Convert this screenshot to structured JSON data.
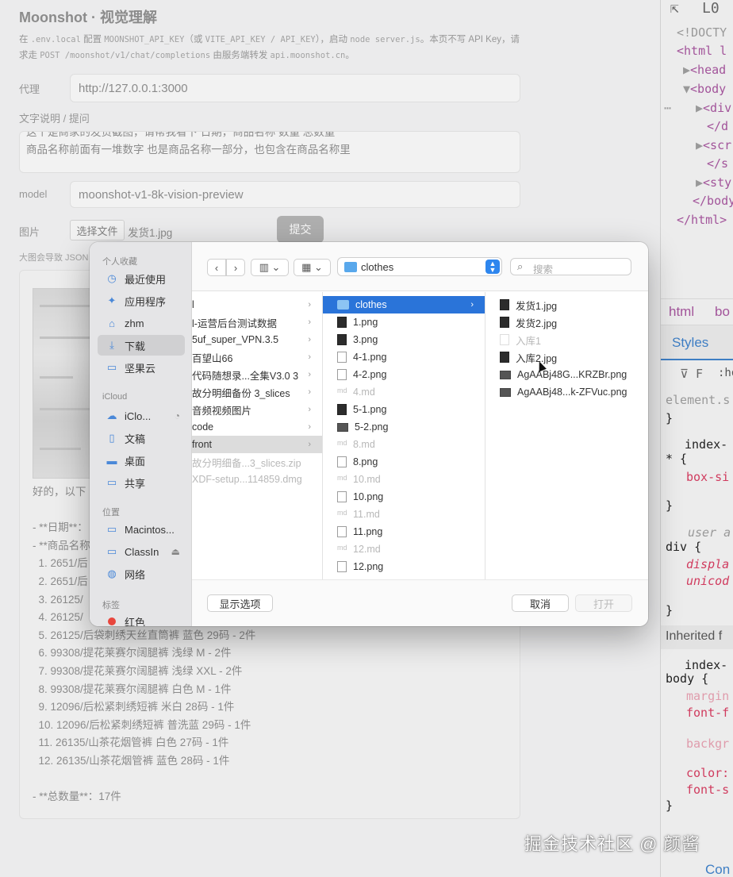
{
  "page": {
    "title": "Moonshot · 视觉理解",
    "desc": {
      "p1": "在 ",
      "c1": ".env.local",
      "p2": " 配置 ",
      "c2": "MOONSHOT_API_KEY",
      "p3": "（或 ",
      "c3": "VITE_API_KEY / API_KEY",
      "p4": "），启动 ",
      "c4": "node server.js",
      "p5": "。本页不写 API Key，请求走 ",
      "c5": "POST /moonshot/v1/chat/completions",
      "p6": " 由服务端转发 ",
      "c6": "api.moonshot.cn",
      "p7": "。"
    },
    "proxy": {
      "label": "代理",
      "value": "http://127.0.0.1:3000"
    },
    "prompt": {
      "label": "文字说明 / 提问",
      "line1": "这个是商家的发货截图，请帮我看下 日期，商品名称 数量 总数量",
      "line2": "商品名称前面有一堆数字 也是商品名称一部分，也包含在商品名称里"
    },
    "model": {
      "label": "model",
      "value": "moonshot-v1-8k-vision-preview"
    },
    "image": {
      "label": "图片",
      "choose_button": "选择文件",
      "file_name": "发货1.jpg"
    },
    "submit": "提交",
    "size_hint": "大图会导致 JSON",
    "result_lines": [
      "好的，以下",
      "",
      "- **日期**：",
      "- **商品名称",
      "  1. 2651/后",
      "  2. 2651/后",
      "  3. 26125/",
      "  4. 26125/",
      "  5. 26125/后袋刺绣天丝直筒裤 蓝色 29码 - 2件",
      "  6. 99308/提花莱赛尔阔腿裤 浅绿 M - 2件",
      "  7. 99308/提花莱赛尔阔腿裤 浅绿 XXL - 2件",
      "  8. 99308/提花莱赛尔阔腿裤 白色 M - 1件",
      "  9. 12096/后松紧刺绣短裤 米白 28码 - 1件",
      "  10. 12096/后松紧刺绣短裤 普洗蓝 29码 - 1件",
      "  11. 26135/山茶花烟管裤 白色 27码 - 1件",
      "  12. 26135/山茶花烟管裤 蓝色 28码 - 1件",
      "",
      "- **总数量**：17件"
    ]
  },
  "devtools": {
    "icon_a": "⇱",
    "icon_b": "L0",
    "doctype": "<!DOCTY",
    "html_open": "<html l",
    "head": "<head",
    "body": "<body",
    "div": "<div",
    "div_close": "</d",
    "script": "<scr",
    "script_close": "</s",
    "style": "<sty",
    "body_close": "</body",
    "html_close": "</html>",
    "crumb_html": "html",
    "crumb_body": "bo",
    "styles_tab": "Styles",
    "filter": ":ho",
    "element_style": "element.s",
    "close_brace": "}",
    "index_1": "index-",
    "star_rule": "* {",
    "box_sizing": "box-si",
    "user_agent": "user a",
    "div_rule": "div {",
    "display": "displa",
    "unicode": "unicod",
    "inherited": "Inherited f",
    "index_2": "index-",
    "body_rule": "body {",
    "margin": "margin",
    "font_f": "font-f",
    "background": "backgr",
    "color": "color:",
    "font_s": "font-s",
    "console": "Con"
  },
  "dialog": {
    "sidebar": {
      "favorites_header": "个人收藏",
      "favorites": [
        {
          "label": "最近使用",
          "icon": "clock-icon"
        },
        {
          "label": "应用程序",
          "icon": "apps-icon"
        },
        {
          "label": "zhm",
          "icon": "home-icon"
        },
        {
          "label": "下载",
          "icon": "download-icon",
          "active": true
        },
        {
          "label": "坚果云",
          "icon": "folder-icon"
        }
      ],
      "icloud_header": "iCloud",
      "icloud": [
        {
          "label": "iClo...",
          "icon": "cloud-icon"
        },
        {
          "label": "文稿",
          "icon": "document-icon"
        },
        {
          "label": "桌面",
          "icon": "desktop-icon"
        },
        {
          "label": "共享",
          "icon": "shared-folder-icon"
        }
      ],
      "locations_header": "位置",
      "locations": [
        {
          "label": "Macintos...",
          "icon": "disk-icon"
        },
        {
          "label": "ClassIn",
          "icon": "disk-icon"
        },
        {
          "label": "网络",
          "icon": "globe-icon"
        }
      ],
      "tags_header": "标签",
      "tags": [
        {
          "label": "红色",
          "color": "#e8463d"
        }
      ]
    },
    "path": "clothes",
    "search_placeholder": "搜索",
    "col1": [
      {
        "name": "l",
        "chev": true
      },
      {
        "name": "l-运营后台测试数据",
        "chev": true
      },
      {
        "name": "5uf_super_VPN.3.5",
        "chev": true
      },
      {
        "name": "百望山66",
        "chev": true
      },
      {
        "name": "代码随想录...全集V3.0 3",
        "chev": true
      },
      {
        "name": "故分明细备份 3_slices",
        "chev": true
      },
      {
        "name": "音频视频图片",
        "chev": true
      },
      {
        "name": "code",
        "chev": true
      },
      {
        "name": "front",
        "chev": true
      },
      {
        "name": "故分明细备...3_slices.zip",
        "chev": false
      },
      {
        "name": "XDF-setup...114859.dmg",
        "chev": false
      }
    ],
    "col2": [
      {
        "name": "clothes",
        "kind": "folder"
      },
      {
        "name": "1.png",
        "kind": "dark"
      },
      {
        "name": "3.png",
        "kind": "dark"
      },
      {
        "name": "4-1.png",
        "kind": "light"
      },
      {
        "name": "4-2.png",
        "kind": "light"
      },
      {
        "name": "4.md",
        "kind": "md"
      },
      {
        "name": "5-1.png",
        "kind": "dark"
      },
      {
        "name": "5-2.png",
        "kind": "wide"
      },
      {
        "name": "8.md",
        "kind": "md"
      },
      {
        "name": "8.png",
        "kind": "light"
      },
      {
        "name": "10.md",
        "kind": "md"
      },
      {
        "name": "10.png",
        "kind": "light"
      },
      {
        "name": "11.md",
        "kind": "md"
      },
      {
        "name": "11.png",
        "kind": "light"
      },
      {
        "name": "12.md",
        "kind": "md"
      },
      {
        "name": "12.png",
        "kind": "light"
      }
    ],
    "col3": [
      {
        "name": "发货1.jpg",
        "kind": "img"
      },
      {
        "name": "发货2.jpg",
        "kind": "img"
      },
      {
        "name": "入库1",
        "kind": "pale"
      },
      {
        "name": "入库2.jpg",
        "kind": "img"
      },
      {
        "name": "AgAABj48G...KRZBr.png",
        "kind": "wide"
      },
      {
        "name": "AgAABj48...k-ZFVuc.png",
        "kind": "wide"
      }
    ],
    "show_options": "显示选项",
    "cancel": "取消",
    "open": "打开"
  },
  "watermark": "掘金技术社区 @ 颜酱"
}
